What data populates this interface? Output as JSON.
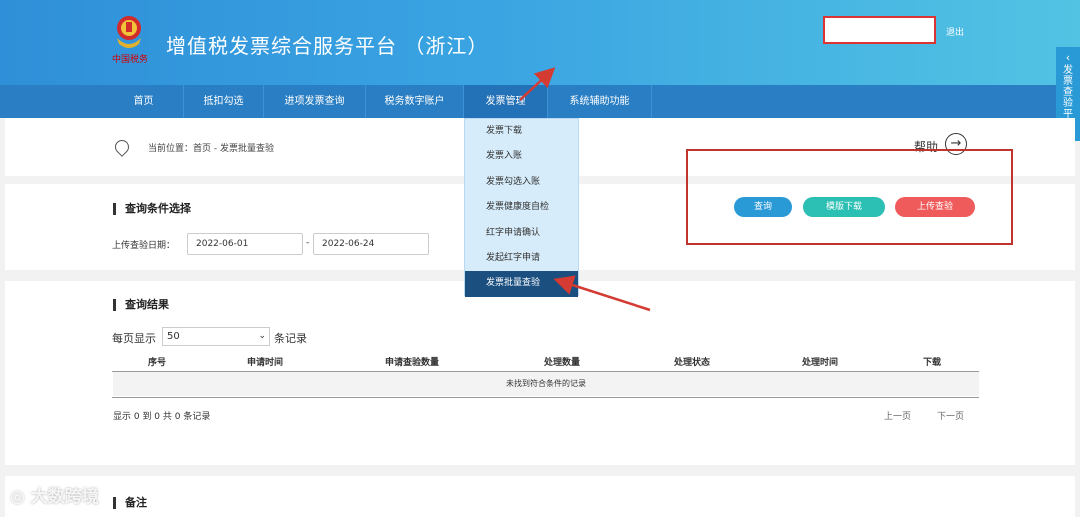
{
  "header": {
    "emblem_subtext": "中国税务",
    "app_title": "增值税发票综合服务平台 （浙江）",
    "logout": "退出",
    "colors": {
      "header_start": "#2f8fd8",
      "header_end": "#52c3e3",
      "nav": "#2a7fc4"
    }
  },
  "nav": {
    "items": [
      {
        "label": "首页"
      },
      {
        "label": "抵扣勾选"
      },
      {
        "label": "进项发票查询"
      },
      {
        "label": "税务数字账户"
      },
      {
        "label": "发票管理"
      },
      {
        "label": "系统辅助功能"
      }
    ]
  },
  "side_tab": {
    "label": "发票查验平台"
  },
  "dropdown": {
    "items": [
      {
        "label": "发票下载"
      },
      {
        "label": "发票入账"
      },
      {
        "label": "发票勾选入账"
      },
      {
        "label": "发票健康度自检"
      },
      {
        "label": "红字申请确认"
      },
      {
        "label": "发起红字申请"
      },
      {
        "label": "发票批量查验"
      }
    ]
  },
  "breadcrumb": {
    "text": "当前位置：首页 - 发票批量查验"
  },
  "help": {
    "label": "帮助"
  },
  "query": {
    "section_title": "查询条件选择",
    "date_label": "上传查验日期：",
    "date_from": "2022-06-01",
    "date_to": "2022-06-24",
    "dash": "-",
    "buttons": {
      "query": {
        "label": "查询",
        "color": "#2a9ad6"
      },
      "template": {
        "label": "模版下载",
        "color": "#2cbfb3"
      },
      "upload": {
        "label": "上传查验",
        "color": "#ef5a5a"
      }
    }
  },
  "results": {
    "section_title": "查询结果",
    "per_page_label": "每页显示",
    "per_page_value": "50",
    "records_word": "条记录",
    "columns": [
      "序号",
      "申请时间",
      "申请查验数量",
      "处理数量",
      "处理状态",
      "处理时间",
      "下载"
    ],
    "empty_text": "未找到符合条件的记录",
    "summary": "显示 0 到 0 共 0 条记录",
    "prev": "上一页",
    "next": "下一页"
  },
  "remark": {
    "title": "备注"
  },
  "watermark": {
    "text": "大数跨境"
  }
}
